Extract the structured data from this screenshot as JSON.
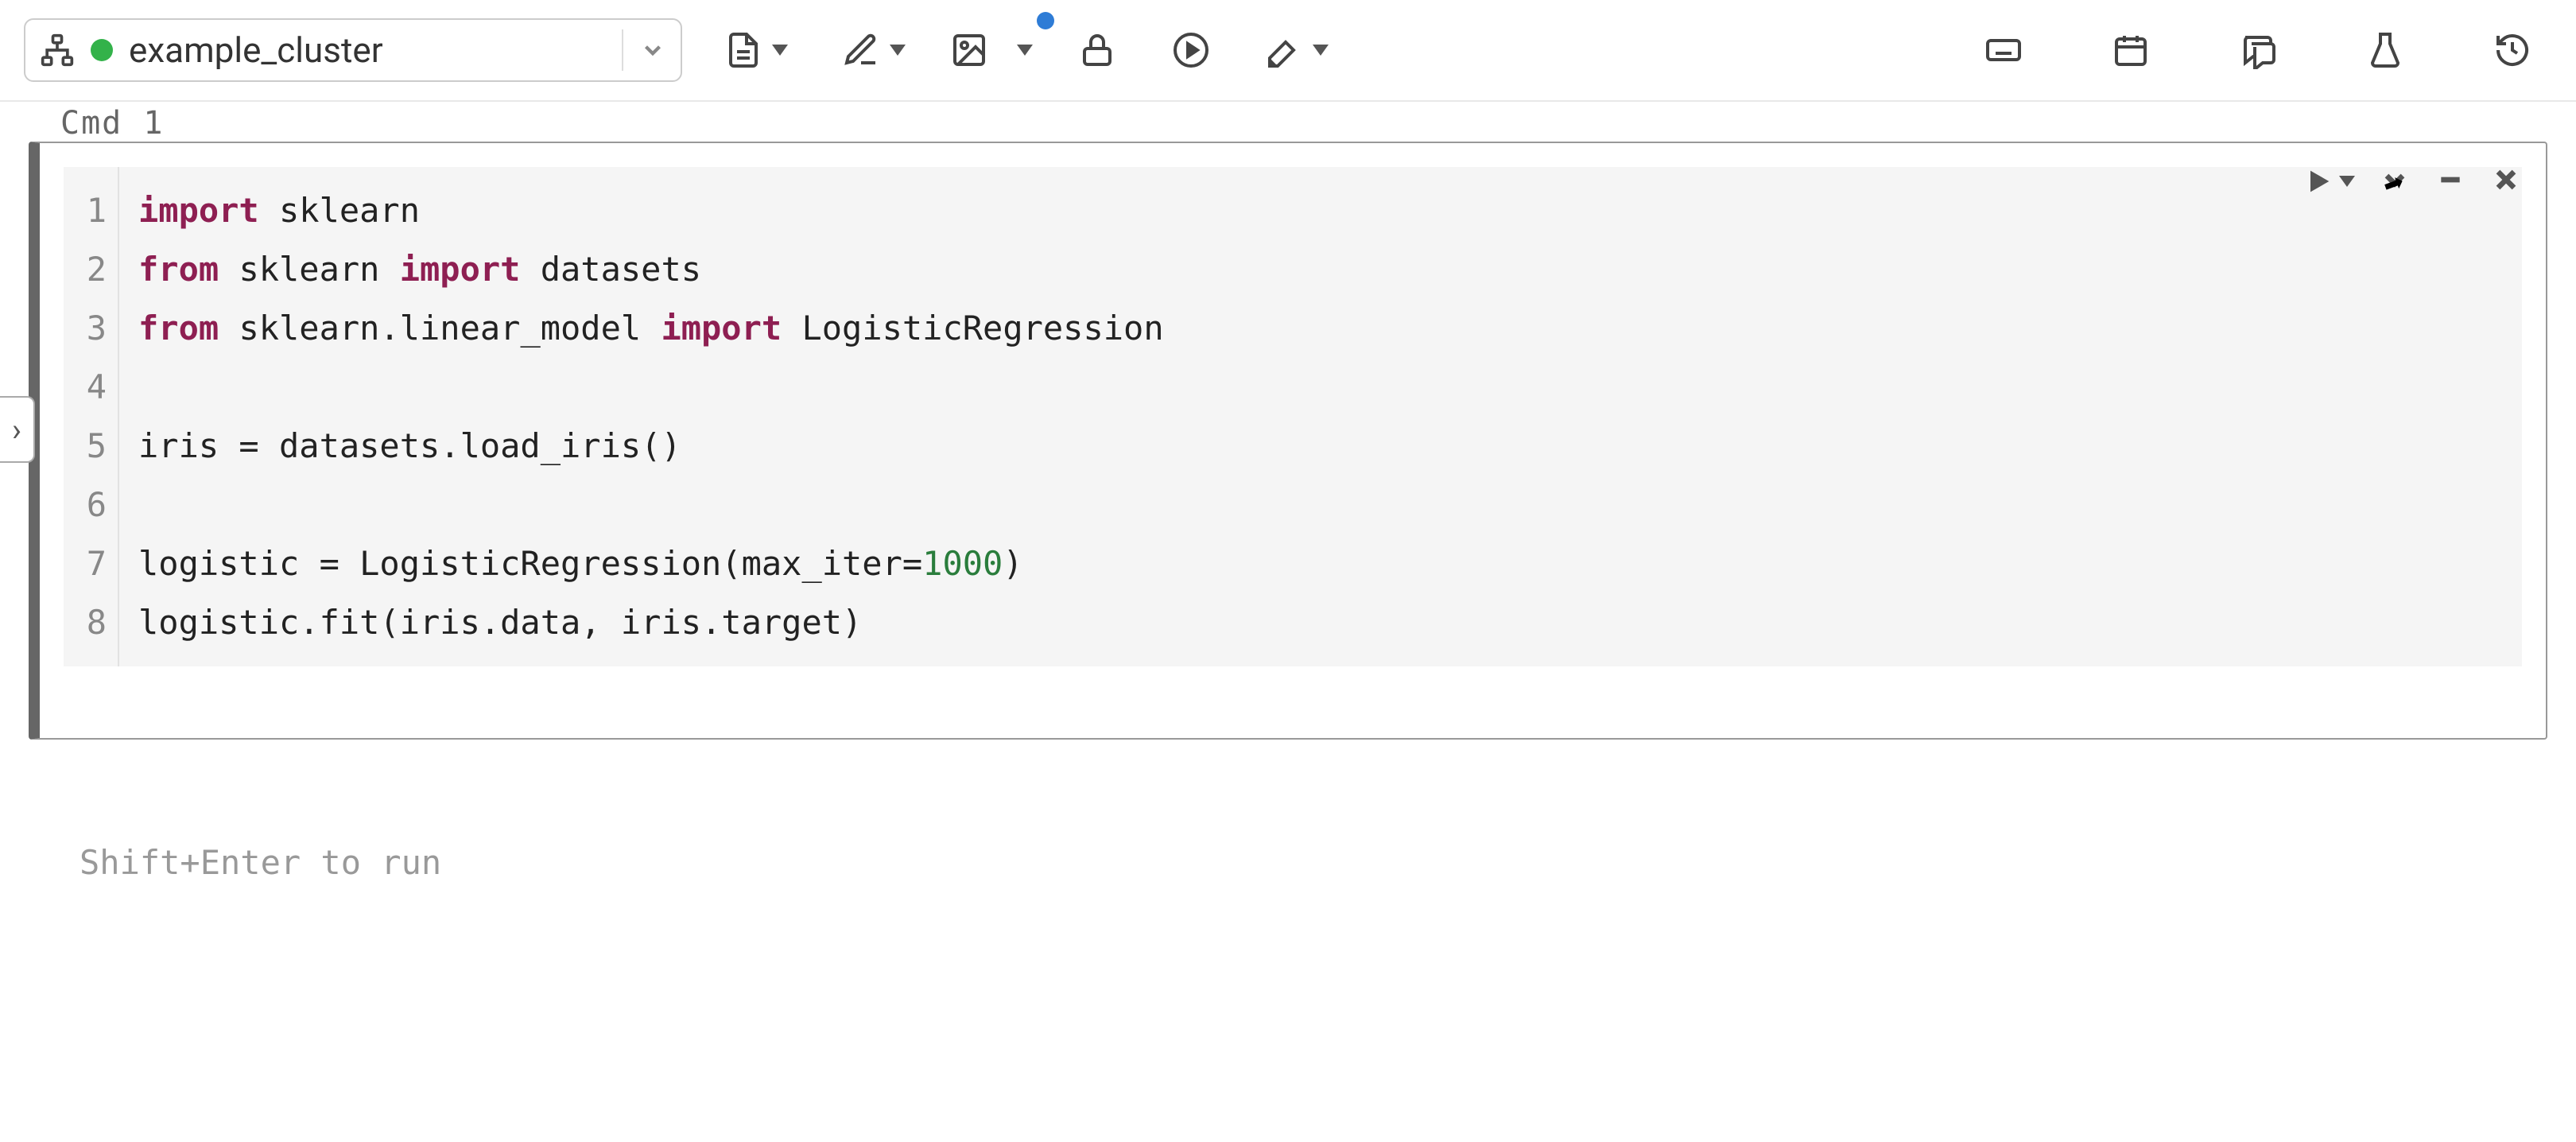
{
  "toolbar": {
    "cluster_name": "example_cluster",
    "cluster_status": "running",
    "icons": {
      "hierarchy": "hierarchy-icon",
      "file": "file-dropdown",
      "edit": "edit-dropdown",
      "image": "image-dropdown",
      "lock": "lock-icon",
      "run_all": "run-all-icon",
      "clear": "clear-dropdown",
      "keyboard": "keyboard-shortcuts-icon",
      "schedule": "schedule-icon",
      "comments": "comments-icon",
      "experiments": "experiments-icon",
      "revision": "revision-history-icon"
    },
    "image_has_notification": true
  },
  "cell": {
    "label": "Cmd 1",
    "line_numbers": [
      "1",
      "2",
      "3",
      "4",
      "5",
      "6",
      "7",
      "8"
    ],
    "code_lines": [
      [
        {
          "t": "import",
          "c": "kw"
        },
        {
          "t": " sklearn",
          "c": ""
        }
      ],
      [
        {
          "t": "from",
          "c": "kw"
        },
        {
          "t": " sklearn ",
          "c": ""
        },
        {
          "t": "import",
          "c": "kw"
        },
        {
          "t": " datasets",
          "c": ""
        }
      ],
      [
        {
          "t": "from",
          "c": "kw"
        },
        {
          "t": " sklearn.linear_model ",
          "c": ""
        },
        {
          "t": "import",
          "c": "kw"
        },
        {
          "t": " LogisticRegression",
          "c": ""
        }
      ],
      [
        {
          "t": "",
          "c": ""
        }
      ],
      [
        {
          "t": "iris = datasets.load_iris()",
          "c": ""
        }
      ],
      [
        {
          "t": "",
          "c": ""
        }
      ],
      [
        {
          "t": "logistic = LogisticRegression(max_iter=",
          "c": ""
        },
        {
          "t": "1000",
          "c": "num"
        },
        {
          "t": ")",
          "c": ""
        }
      ],
      [
        {
          "t": "logistic.fit(iris.data, iris.target)",
          "c": ""
        }
      ]
    ],
    "actions": {
      "run": "run-cell",
      "expand_down": "move-down",
      "minimize": "minimize-cell",
      "close": "delete-cell"
    }
  },
  "hint": "Shift+Enter to run"
}
